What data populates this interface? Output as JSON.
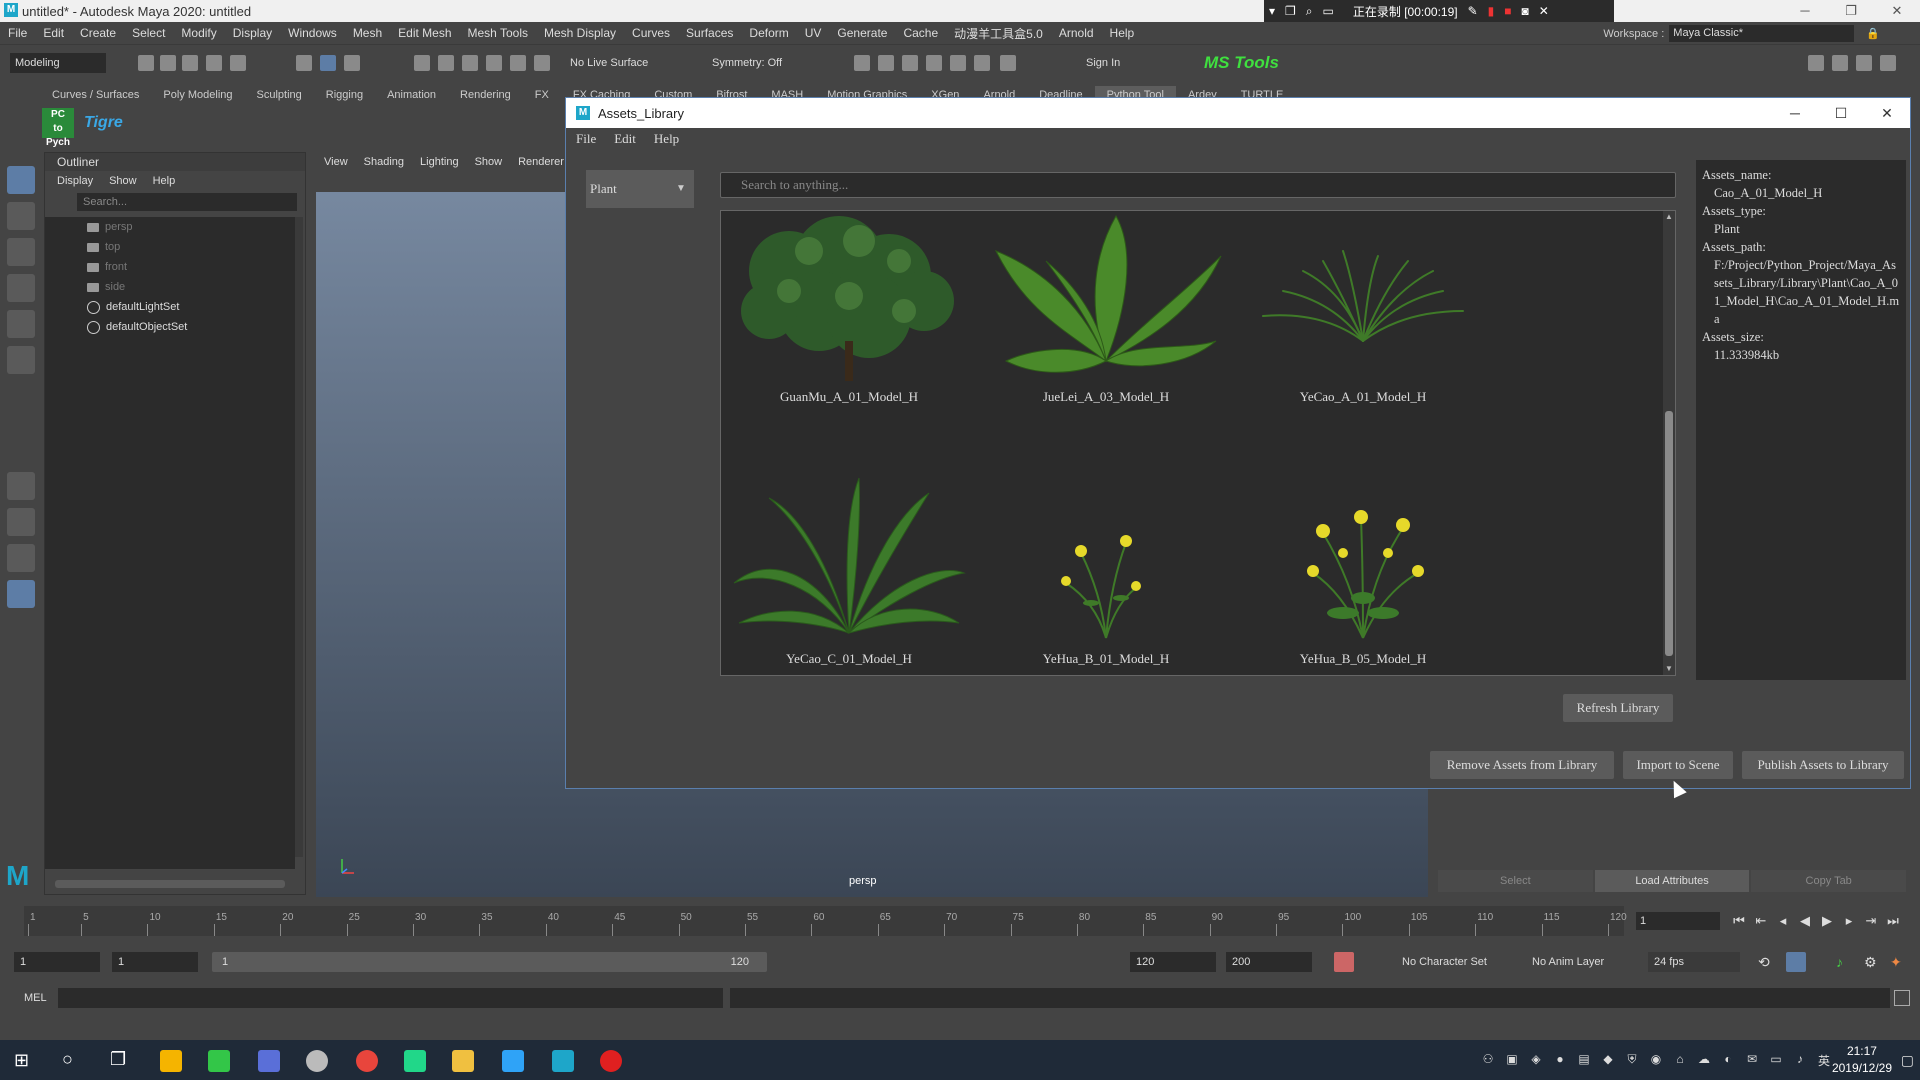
{
  "window": {
    "title": "untitled* - Autodesk Maya 2020: untitled",
    "recording": "正在录制 [00:00:19]"
  },
  "menubar": [
    "File",
    "Edit",
    "Create",
    "Select",
    "Modify",
    "Display",
    "Windows",
    "Mesh",
    "Edit Mesh",
    "Mesh Tools",
    "Mesh Display",
    "Curves",
    "Surfaces",
    "Deform",
    "UV",
    "Generate",
    "Cache",
    "动漫羊工具盒5.0",
    "Arnold",
    "Help"
  ],
  "workspace": {
    "label": "Workspace :",
    "value": "Maya Classic*"
  },
  "toolbar": {
    "mode": "Modeling",
    "live_surface": "No Live Surface",
    "symmetry": "Symmetry: Off",
    "sign_in": "Sign In",
    "mstools": "MS Tools"
  },
  "shelf_tabs": [
    "Curves / Surfaces",
    "Poly Modeling",
    "Sculpting",
    "Rigging",
    "Animation",
    "Rendering",
    "FX",
    "FX Caching",
    "Custom",
    "Bifrost",
    "MASH",
    "Motion Graphics",
    "XGen",
    "Arnold",
    "Deadline",
    "Python Tool",
    "Ardev",
    "TURTLE"
  ],
  "outliner": {
    "title": "Outliner",
    "menu": [
      "Display",
      "Show",
      "Help"
    ],
    "search_placeholder": "Search...",
    "items": [
      {
        "label": "persp",
        "type": "camera"
      },
      {
        "label": "top",
        "type": "camera"
      },
      {
        "label": "front",
        "type": "camera"
      },
      {
        "label": "side",
        "type": "camera"
      },
      {
        "label": "defaultLightSet",
        "type": "set"
      },
      {
        "label": "defaultObjectSet",
        "type": "set"
      }
    ]
  },
  "viewport": {
    "menu": [
      "View",
      "Shading",
      "Lighting",
      "Show",
      "Renderer"
    ],
    "camera": "persp"
  },
  "dialog": {
    "title": "Assets_Library",
    "menu": [
      "File",
      "Edit",
      "Help"
    ],
    "category": "Plant",
    "search_placeholder": "Search to anything...",
    "assets": [
      {
        "name": "GuanMu_A_01_Model_H",
        "kind": "shrub"
      },
      {
        "name": "JueLei_A_03_Model_H",
        "kind": "broadleaf"
      },
      {
        "name": "YeCao_A_01_Model_H",
        "kind": "grass"
      },
      {
        "name": "YeCao_C_01_Model_H",
        "kind": "longgrass"
      },
      {
        "name": "YeHua_B_01_Model_H",
        "kind": "flower-small"
      },
      {
        "name": "YeHua_B_05_Model_H",
        "kind": "flower-big"
      }
    ],
    "info": {
      "name_label": "Assets_name:",
      "name": "Cao_A_01_Model_H",
      "type_label": "Assets_type:",
      "type": "Plant",
      "path_label": "Assets_path:",
      "path": "F:/Project/Python_Project/Maya_Assets_Library/Library\\Plant\\Cao_A_01_Model_H\\Cao_A_01_Model_H.ma",
      "size_label": "Assets_size:",
      "size": "11.333984kb"
    },
    "buttons": {
      "refresh": "Refresh Library",
      "remove": "Remove Assets from Library",
      "import": "Import to Scene",
      "publish": "Publish Assets to Library"
    }
  },
  "attr_tabs": [
    "Select",
    "Load Attributes",
    "Copy Tab"
  ],
  "timeline": {
    "ticks": [
      1,
      5,
      10,
      15,
      20,
      25,
      30,
      35,
      40,
      45,
      50,
      55,
      60,
      65,
      70,
      75,
      80,
      85,
      90,
      95,
      100,
      105,
      110,
      115,
      120
    ],
    "current_frame": "1"
  },
  "range": {
    "start": "1",
    "start2": "1",
    "slider_start": "1",
    "slider_end": "120",
    "end": "120",
    "end2": "200",
    "character_set": "No Character Set",
    "anim_layer": "No Anim Layer",
    "fps": "24 fps"
  },
  "mel": {
    "label": "MEL"
  },
  "taskbar": {
    "time": "21:17",
    "date": "2019/12/29",
    "ime": "英"
  }
}
